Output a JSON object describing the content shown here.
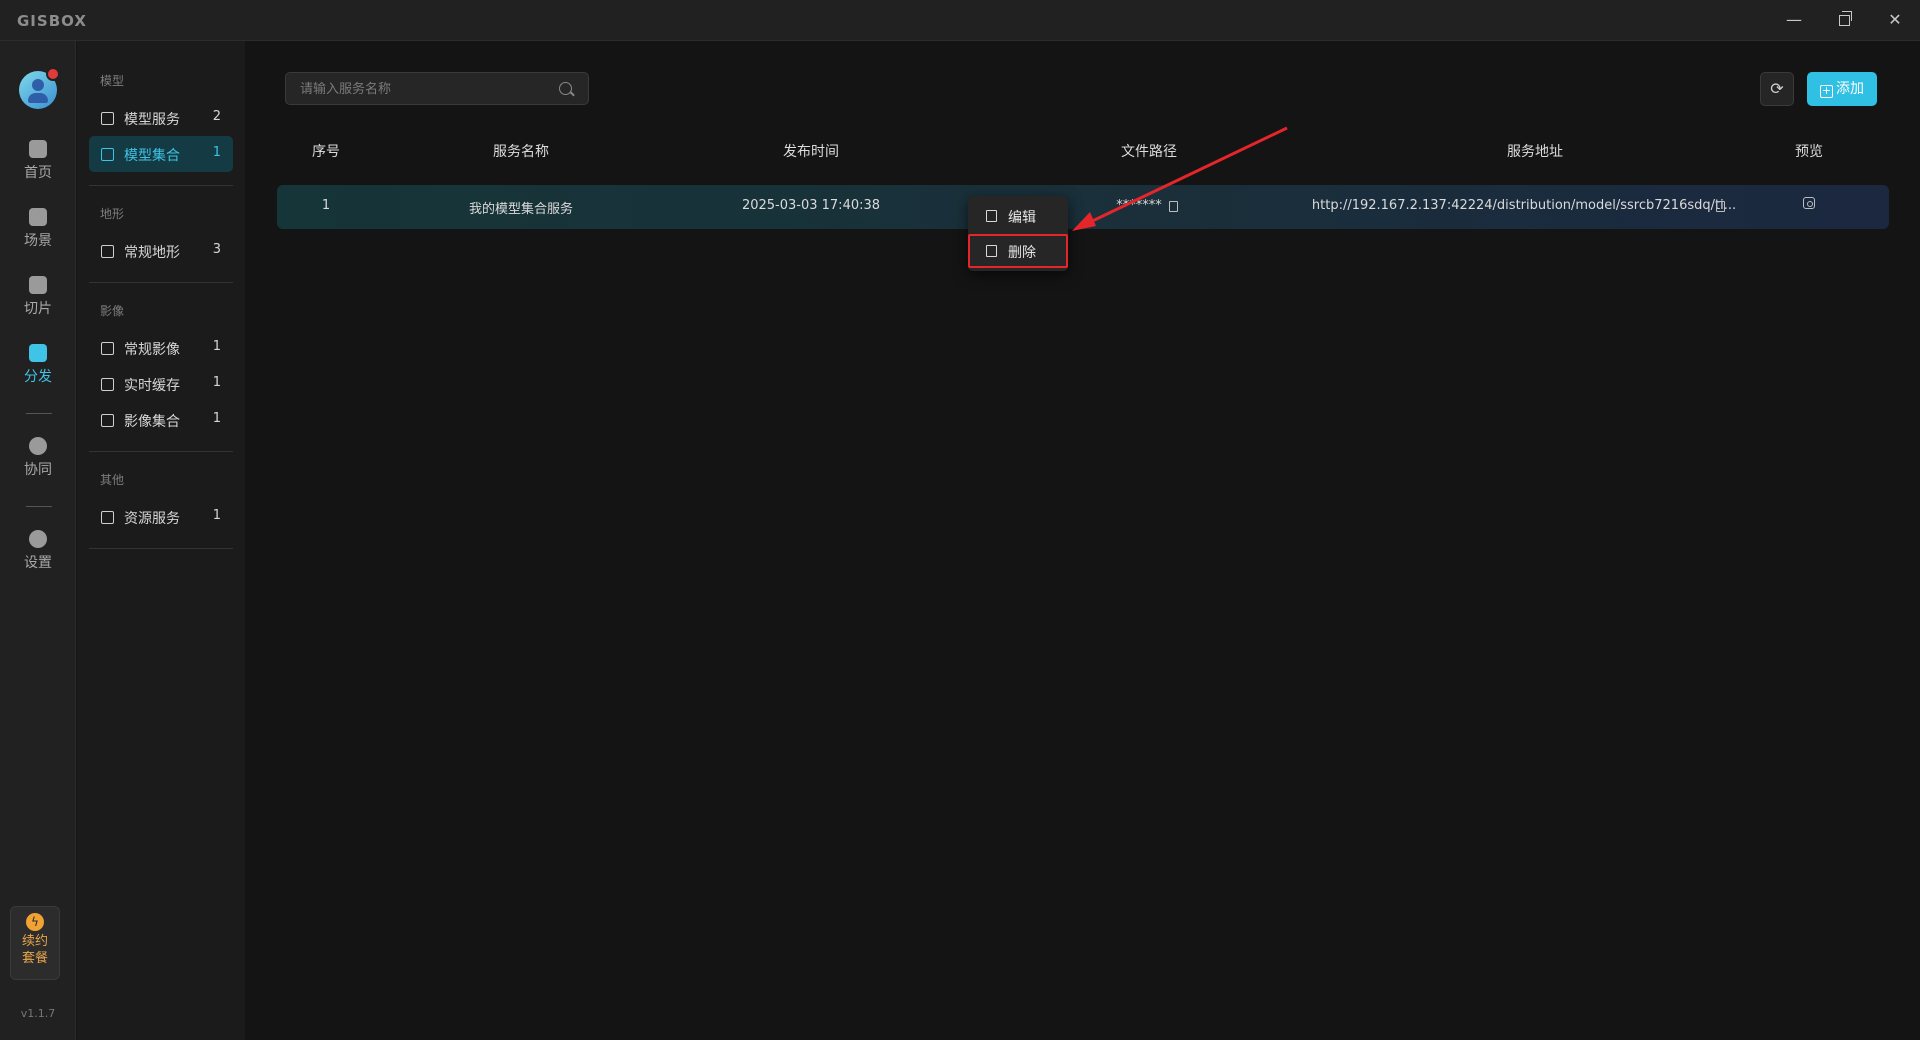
{
  "app": {
    "logo": "GISBOX"
  },
  "window": {
    "minimize": "—",
    "close": "✕"
  },
  "rail": {
    "items": [
      {
        "label": "首页",
        "icon": "home-icon"
      },
      {
        "label": "场景",
        "icon": "scene-icon"
      },
      {
        "label": "切片",
        "icon": "slice-icon"
      },
      {
        "label": "分发",
        "icon": "distribute-icon"
      },
      {
        "label": "协同",
        "icon": "collaborate-icon"
      },
      {
        "label": "设置",
        "icon": "settings-icon"
      }
    ],
    "active": "分发",
    "renew_line1": "续约",
    "renew_line2": "套餐",
    "renew_icon": "ϟ",
    "version": "v1.1.7"
  },
  "subnav": {
    "groups": [
      {
        "title": "模型",
        "items": [
          {
            "label": "模型服务",
            "count": "2"
          },
          {
            "label": "模型集合",
            "count": "1"
          }
        ]
      },
      {
        "title": "地形",
        "items": [
          {
            "label": "常规地形",
            "count": "3"
          }
        ]
      },
      {
        "title": "影像",
        "items": [
          {
            "label": "常规影像",
            "count": "1"
          },
          {
            "label": "实时缓存",
            "count": "1"
          },
          {
            "label": "影像集合",
            "count": "1"
          }
        ]
      },
      {
        "title": "其他",
        "items": [
          {
            "label": "资源服务",
            "count": "1"
          }
        ]
      }
    ],
    "active": "模型集合"
  },
  "toolbar": {
    "search_placeholder": "请输入服务名称",
    "refresh_icon": "⟳",
    "add_label": "添加",
    "add_icon": "+"
  },
  "table": {
    "columns": [
      "序号",
      "服务名称",
      "发布时间",
      "文件路径",
      "服务地址",
      "预览"
    ],
    "rows": [
      {
        "index": "1",
        "name": "我的模型集合服务",
        "time": "2025-03-03 17:40:38",
        "path": "*******",
        "address": "http://192.167.2.137:42224/distribution/model/ssrcb7216sdq/ti..."
      }
    ]
  },
  "context_menu": {
    "edit": "编辑",
    "delete": "删除"
  },
  "colors": {
    "accent": "#2fc0e4",
    "highlight_box": "#e4262a",
    "annotation_arrow": "#e4262a"
  }
}
